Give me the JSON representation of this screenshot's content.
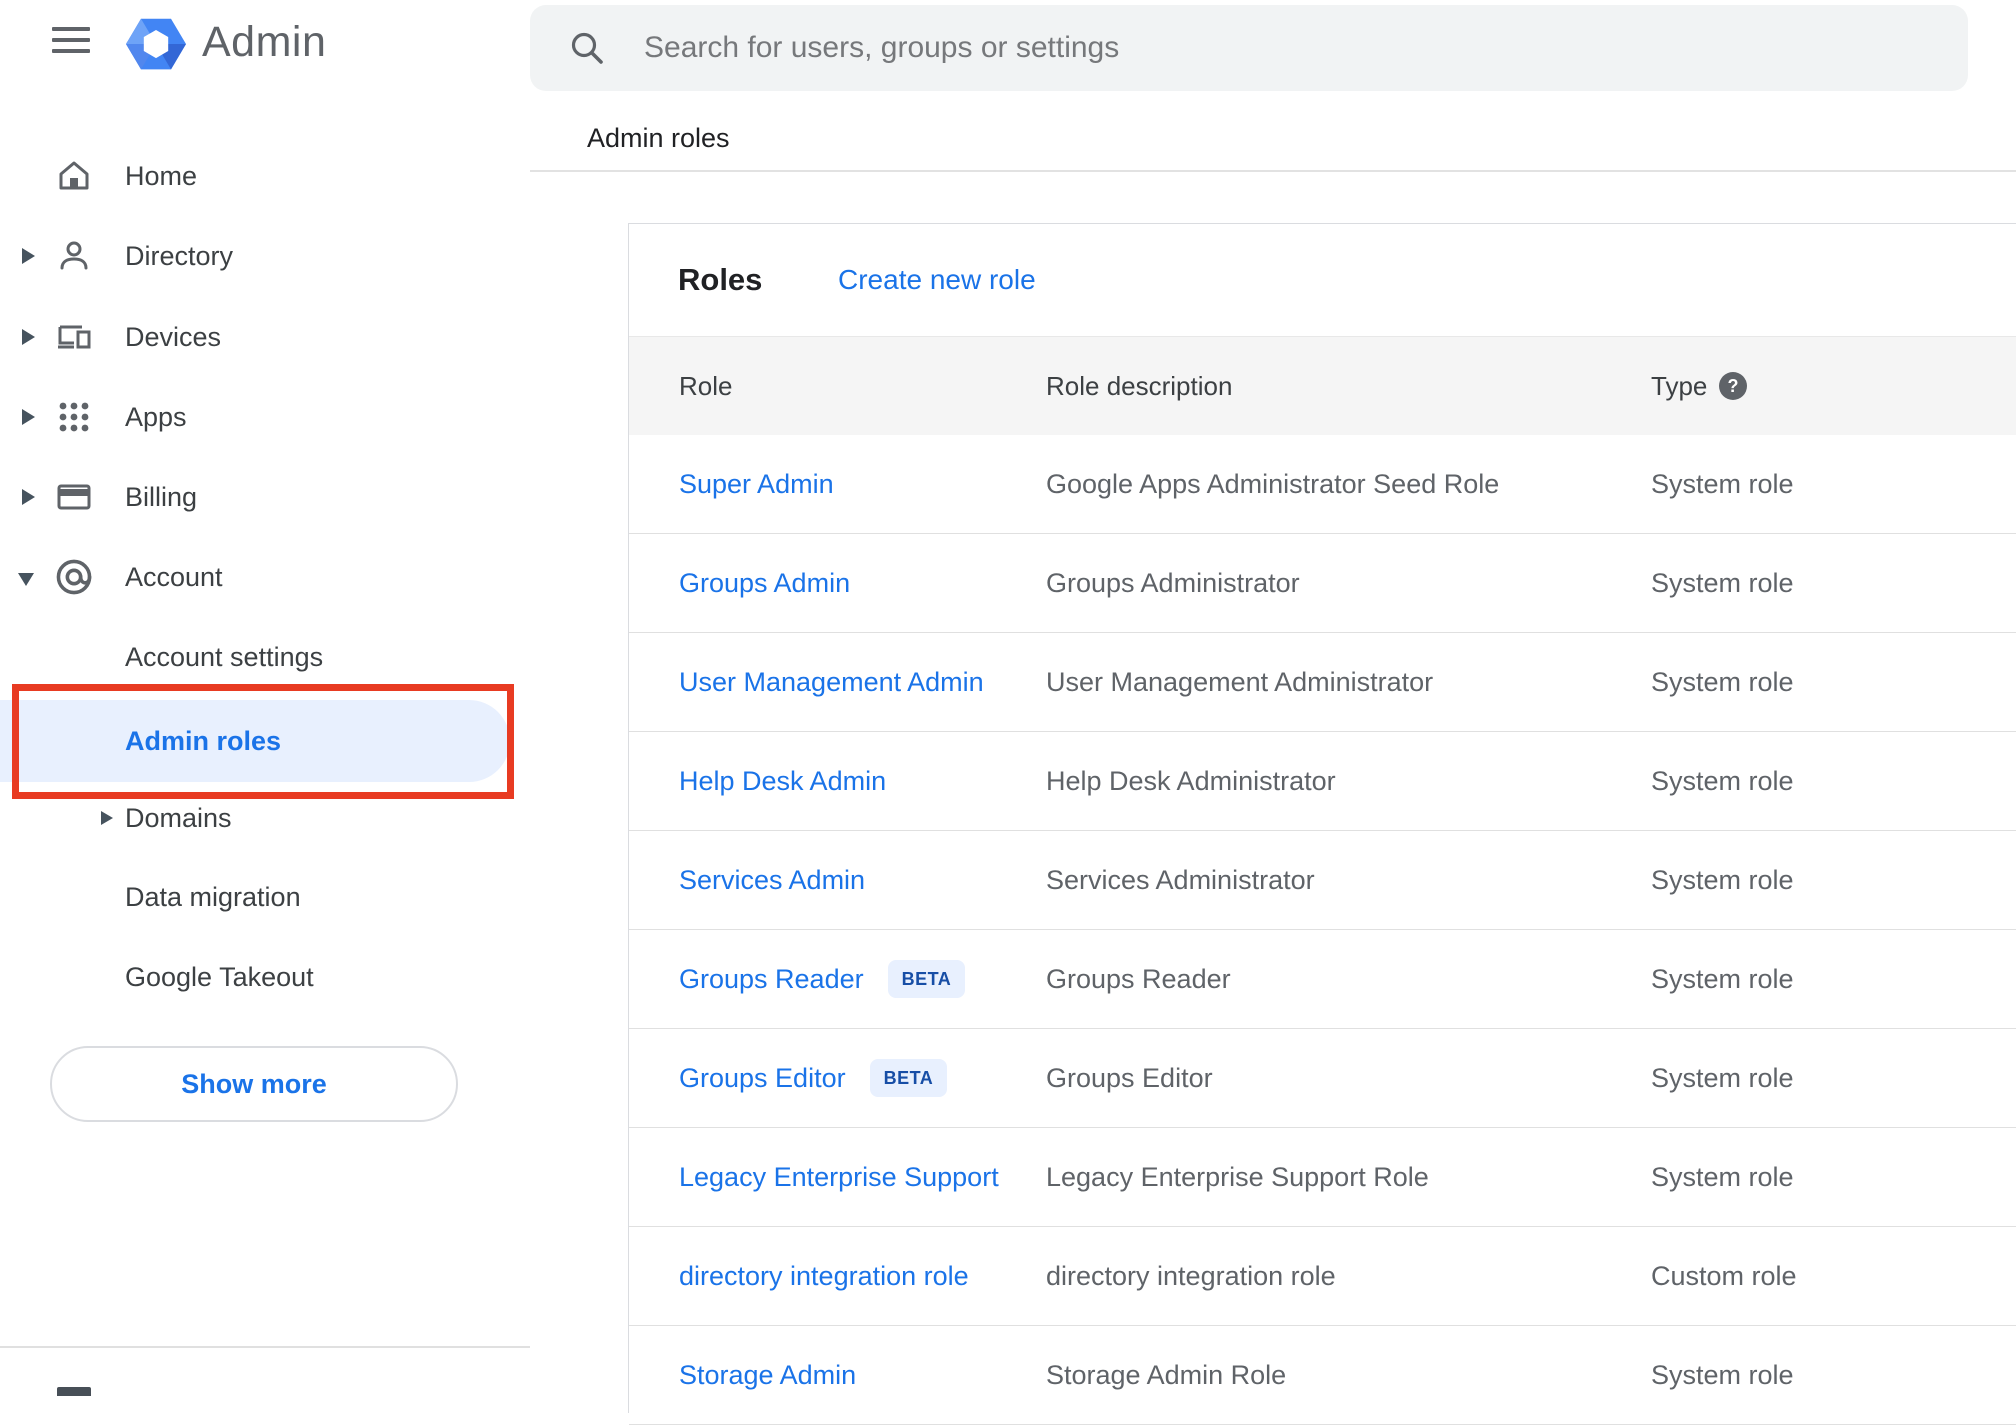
{
  "app": {
    "brand": "Admin"
  },
  "search": {
    "placeholder": "Search for users, groups or settings"
  },
  "breadcrumb": "Admin roles",
  "sidebar": {
    "items": [
      {
        "label": "Home",
        "icon": "home-icon",
        "expandable": false
      },
      {
        "label": "Directory",
        "icon": "person-icon",
        "expandable": true
      },
      {
        "label": "Devices",
        "icon": "devices-icon",
        "expandable": true
      },
      {
        "label": "Apps",
        "icon": "apps-grid-icon",
        "expandable": true
      },
      {
        "label": "Billing",
        "icon": "credit-card-icon",
        "expandable": true
      },
      {
        "label": "Account",
        "icon": "at-sign-icon",
        "expandable": true,
        "expanded": true
      }
    ],
    "sub_items": [
      {
        "label": "Account settings",
        "active": false
      },
      {
        "label": "Admin roles",
        "active": true,
        "annotated": "red-box"
      },
      {
        "label": "Domains",
        "expandable": true
      },
      {
        "label": "Data migration"
      },
      {
        "label": "Google Takeout"
      }
    ],
    "show_more_label": "Show more"
  },
  "main": {
    "card_title": "Roles",
    "create_link_label": "Create new role",
    "columns": {
      "role": "Role",
      "description": "Role description",
      "type": "Type"
    },
    "type_help_icon": "?",
    "beta_label": "BETA",
    "rows": [
      {
        "role": "Super Admin",
        "beta": false,
        "description": "Google Apps Administrator Seed Role",
        "type": "System role"
      },
      {
        "role": "Groups Admin",
        "beta": false,
        "description": "Groups Administrator",
        "type": "System role"
      },
      {
        "role": "User Management Admin",
        "beta": false,
        "description": "User Management Administrator",
        "type": "System role"
      },
      {
        "role": "Help Desk Admin",
        "beta": false,
        "description": "Help Desk Administrator",
        "type": "System role"
      },
      {
        "role": "Services Admin",
        "beta": false,
        "description": "Services Administrator",
        "type": "System role"
      },
      {
        "role": "Groups Reader",
        "beta": true,
        "description": "Groups Reader",
        "type": "System role"
      },
      {
        "role": "Groups Editor",
        "beta": true,
        "description": "Groups Editor",
        "type": "System role"
      },
      {
        "role": "Legacy Enterprise Support",
        "beta": false,
        "description": "Legacy Enterprise Support Role",
        "type": "System role"
      },
      {
        "role": "directory integration role",
        "beta": false,
        "description": "directory integration role",
        "type": "Custom role"
      },
      {
        "role": "Storage Admin",
        "beta": false,
        "description": "Storage Admin Role",
        "type": "System role"
      }
    ]
  },
  "colors": {
    "accent_blue": "#1a73e8",
    "active_item_bg": "#e8f0fe",
    "annotation_red": "#e83b22",
    "badge_bg": "#e8f0fe",
    "badge_text": "#174ea6",
    "header_band_bg": "#f5f5f5",
    "body_text": "#3c4043",
    "muted_text": "#5f6368",
    "divider": "#e0e0e0",
    "search_bg": "#f1f3f4"
  }
}
